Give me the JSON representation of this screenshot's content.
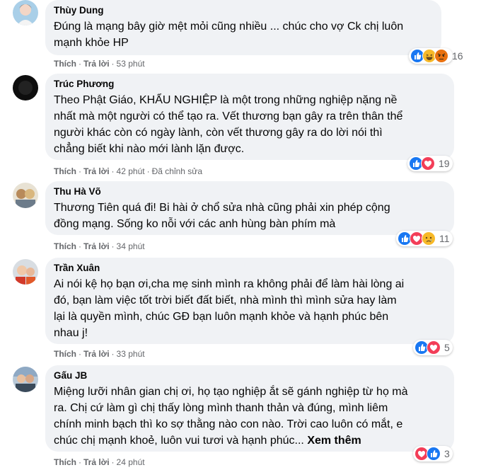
{
  "action_labels": {
    "like": "Thích",
    "reply": "Trả lời",
    "separator": "·"
  },
  "see_more_label": "Xem thêm",
  "comments": [
    {
      "author": "Thùy Dung",
      "text": "Đúng là mạng bây giờ mệt mỏi cũng nhiều ... chúc cho vợ Ck chị luôn\nmạnh khỏe HP",
      "time": "53 phút",
      "edited": "",
      "reactions": [
        "like",
        "haha",
        "angry"
      ],
      "reaction_count": "16"
    },
    {
      "author": "Trúc Phương",
      "text": "Theo Phật Giáo, KHẨU NGHIỆP là một trong những nghiệp nặng nề\nnhất mà một người có thể tạo ra. Vết thương bạn gây ra trên thân thể\nngười khác còn có ngày lành, còn vết thương gây ra do lời nói thì\nchẳng biết khi nào mới lành lặn được.",
      "time": "42 phút",
      "edited": "Đã chỉnh sửa",
      "reactions": [
        "like",
        "love"
      ],
      "reaction_count": "19"
    },
    {
      "author": "Thu Hà Võ",
      "text": "Thương Tiên quá đi! Bi hài ở chổ sửa nhà cũng phải xin phép cộng\nđồng mạng. Sống ko nỗi với các anh hùng bàn phím mà",
      "time": "34 phút",
      "edited": "",
      "reactions": [
        "like",
        "love",
        "sad"
      ],
      "reaction_count": "11"
    },
    {
      "author": "Trần Xuân",
      "text": "Ai nói kệ họ bạn ơi,cha mẹ sinh mình ra không phải để làm hài lòng ai\nđó, bạn làm việc tốt trời biết đất biết, nhà mình thì mình sửa hay làm\nlại là quyền mình, chúc GĐ bạn luôn mạnh khỏe và hạnh phúc bên\nnhau j!",
      "time": "33 phút",
      "edited": "",
      "reactions": [
        "like",
        "love"
      ],
      "reaction_count": "5"
    },
    {
      "author": "Gấu JB",
      "text": "Miệng lưỡi nhân gian chị ơi, họ tạo nghiệp ắt sẽ gánh nghiệp từ họ mà\nra. Chị cứ làm gì chị thấy lòng mình thanh thản và đúng, mình liêm\nchính minh bạch thì ko sợ thằng nào con nào. Trời cao luôn có mắt, e\nchúc chị mạnh khoẻ, luôn vui tươi và hạnh phúc...",
      "time": "24 phút",
      "edited": "",
      "reactions": [
        "love",
        "like"
      ],
      "reaction_count": "3"
    }
  ],
  "colors": {
    "bubble": "#f0f2f5",
    "meta_text": "#65676b",
    "like_blue": "#1877f2",
    "love_red": "#f33e58",
    "emoji_yellow": "#f7b928",
    "angry_orange": "#e9710f"
  }
}
